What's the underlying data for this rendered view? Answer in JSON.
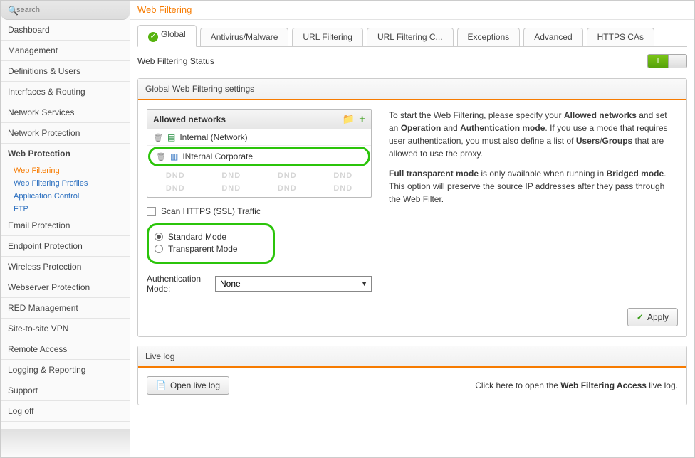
{
  "search": {
    "placeholder": "search"
  },
  "sidebar": {
    "items": [
      "Dashboard",
      "Management",
      "Definitions & Users",
      "Interfaces & Routing",
      "Network Services",
      "Network Protection"
    ],
    "active_group": "Web Protection",
    "sub_items": [
      "Web Filtering",
      "Web Filtering Profiles",
      "Application Control",
      "FTP"
    ],
    "items_after": [
      "Email Protection",
      "Endpoint Protection",
      "Wireless Protection",
      "Webserver Protection",
      "RED Management",
      "Site-to-site VPN",
      "Remote Access",
      "Logging & Reporting",
      "Support",
      "Log off"
    ]
  },
  "page_title": "Web Filtering",
  "tabs": [
    "Global",
    "Antivirus/Malware",
    "URL Filtering",
    "URL Filtering C...",
    "Exceptions",
    "Advanced",
    "HTTPS CAs"
  ],
  "status_label": "Web Filtering Status",
  "toggle_state": "I",
  "panel1": {
    "heading": "Global Web Filtering settings",
    "networks": {
      "title": "Allowed networks",
      "rows": [
        {
          "label": "Internal (Network)",
          "icon": "int"
        },
        {
          "label": "INternal Corporate",
          "icon": "net",
          "highlight": true
        }
      ],
      "dnd": "DND"
    },
    "scan_label": "Scan HTTPS (SSL) Traffic",
    "modes": {
      "standard": "Standard Mode",
      "transparent": "Transparent Mode"
    },
    "auth_label": "Authentication Mode:",
    "auth_value": "None",
    "apply": "Apply",
    "help": {
      "p1a": "To start the Web Filtering, please specify your ",
      "p1b": "Allowed networks",
      "p1c": " and set an ",
      "p1d": "Operation",
      "p1e": " and ",
      "p1f": "Authentication mode",
      "p1g": ". If you use a mode that requires user authentication, you must also define a list of ",
      "p1h": "Users",
      "p1i": "/",
      "p1j": "Groups",
      "p1k": " that are allowed to use the proxy.",
      "p2a": "Full transparent mode",
      "p2b": " is only available when running in ",
      "p2c": "Bridged mode",
      "p2d": ". This option will preserve the source IP addresses after they pass through the Web Filter."
    }
  },
  "panel2": {
    "heading": "Live log",
    "button": "Open live log",
    "hint_a": "Click here to open the ",
    "hint_b": "Web Filtering Access",
    "hint_c": " live log."
  }
}
